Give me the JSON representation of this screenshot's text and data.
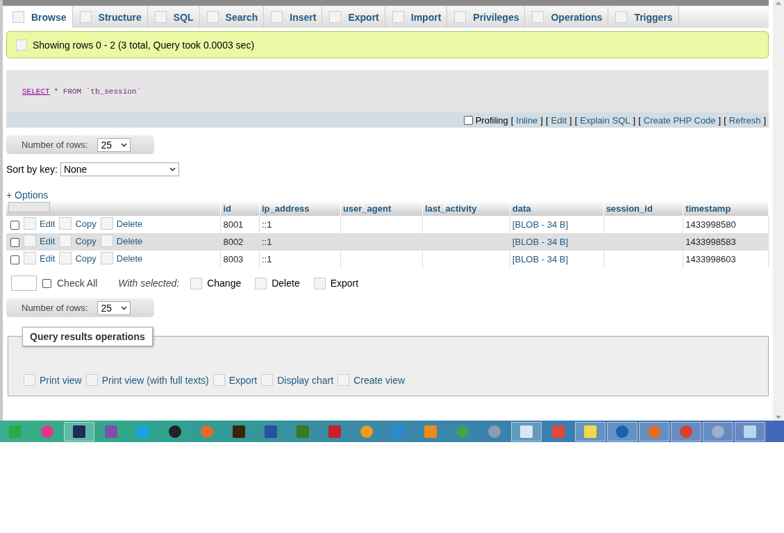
{
  "tabs": [
    {
      "label": "Browse",
      "selected": true
    },
    {
      "label": "Structure",
      "selected": false
    },
    {
      "label": "SQL",
      "selected": false
    },
    {
      "label": "Search",
      "selected": false
    },
    {
      "label": "Insert",
      "selected": false
    },
    {
      "label": "Export",
      "selected": false
    },
    {
      "label": "Import",
      "selected": false
    },
    {
      "label": "Privileges",
      "selected": false
    },
    {
      "label": "Operations",
      "selected": false
    },
    {
      "label": "Triggers",
      "selected": false
    }
  ],
  "notice": "Showing rows 0 - 2 (3 total, Query took 0.0003 sec)",
  "sql": {
    "keyword": "SELECT",
    "rest": "* FROM `tb_session`"
  },
  "sql_actions": {
    "profiling": {
      "label": "Profiling",
      "checked": false
    },
    "links": [
      {
        "open": "[",
        "label": "Inline",
        "close": "]"
      },
      {
        "open": "[",
        "label": "Edit",
        "close": "]"
      },
      {
        "open": "[",
        "label": "Explain SQL",
        "close": "]"
      },
      {
        "open": "[",
        "label": "Create PHP Code",
        "close": "]"
      },
      {
        "open": "[",
        "label": "Refresh",
        "close": "]"
      }
    ]
  },
  "rows_nav_top": {
    "label": "Number of rows:",
    "value": "25"
  },
  "sort": {
    "label": "Sort by key:",
    "value": "None"
  },
  "options_link": "+ Options",
  "table": {
    "columns": [
      "id",
      "ip_address",
      "user_agent",
      "last_activity",
      "data",
      "session_id",
      "timestamp"
    ],
    "rows": [
      {
        "checked": false,
        "actions": [
          "Edit",
          "Copy",
          "Delete"
        ],
        "cells": [
          "8001",
          "::1",
          "",
          "",
          "[BLOB - 34 B]",
          "",
          "1433998580"
        ]
      },
      {
        "checked": false,
        "actions": [
          "Edit",
          "Copy",
          "Delete"
        ],
        "cells": [
          "8002",
          "::1",
          "",
          "",
          "[BLOB - 34 B]",
          "",
          "1433998583"
        ]
      },
      {
        "checked": false,
        "actions": [
          "Edit",
          "Copy",
          "Delete"
        ],
        "cells": [
          "8003",
          "::1",
          "",
          "",
          "[BLOB - 34 B]",
          "",
          "1433998603"
        ]
      }
    ]
  },
  "bulk": {
    "check_all": {
      "label": "Check All",
      "checked": false
    },
    "with_selected": "With selected:",
    "actions": [
      "Change",
      "Delete",
      "Export"
    ]
  },
  "rows_nav_bottom": {
    "label": "Number of rows:",
    "value": "25"
  },
  "operations": {
    "legend": "Query results operations",
    "links": [
      "Print view",
      "Print view (with full texts)",
      "Export",
      "Display chart",
      "Create view"
    ]
  },
  "taskbar": [
    {
      "kind": "square",
      "color": "#2ba84a",
      "running": false
    },
    {
      "kind": "circle",
      "color": "#e8338c",
      "running": false
    },
    {
      "kind": "square",
      "color": "#1c2a5c",
      "running": true
    },
    {
      "kind": "square",
      "color": "#7d4fa8",
      "running": false
    },
    {
      "kind": "square",
      "color": "#1aa3e0",
      "running": false
    },
    {
      "kind": "circle",
      "color": "#222222",
      "running": false
    },
    {
      "kind": "circle",
      "color": "#e8682a",
      "running": false
    },
    {
      "kind": "square",
      "color": "#3a2408",
      "running": false
    },
    {
      "kind": "square",
      "color": "#2b4ea0",
      "running": false
    },
    {
      "kind": "square",
      "color": "#3b7a1c",
      "running": false
    },
    {
      "kind": "square",
      "color": "#c8202a",
      "running": false
    },
    {
      "kind": "circle",
      "color": "#f29a1a",
      "running": false
    },
    {
      "kind": "circle",
      "color": "#2a8ad8",
      "running": false
    },
    {
      "kind": "square",
      "color": "#f08a1a",
      "running": false
    },
    {
      "kind": "circle",
      "color": "#3aa64a",
      "running": false
    },
    {
      "kind": "circle",
      "color": "#8a9cb0",
      "running": false
    },
    {
      "kind": "square",
      "color": "#dde6f0",
      "running": true
    },
    {
      "kind": "square",
      "color": "#e04a3a",
      "running": false
    },
    {
      "kind": "square",
      "color": "#f2d84a",
      "running": true
    },
    {
      "kind": "circle",
      "color": "#1a5fb0",
      "running": true
    },
    {
      "kind": "circle",
      "color": "#e86a1a",
      "running": true
    },
    {
      "kind": "circle",
      "color": "#d8402a",
      "running": true
    },
    {
      "kind": "circle",
      "color": "#a0b0c8",
      "running": true
    },
    {
      "kind": "square",
      "color": "#b8d8e8",
      "running": true
    }
  ]
}
